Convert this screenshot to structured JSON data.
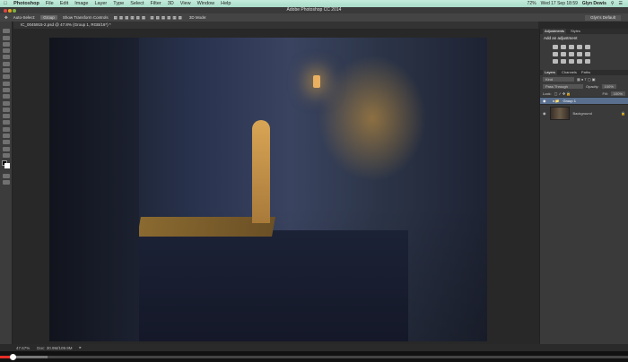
{
  "menubar": {
    "app": "Photoshop",
    "items": [
      "File",
      "Edit",
      "Image",
      "Layer",
      "Type",
      "Select",
      "Filter",
      "3D",
      "View",
      "Window",
      "Help"
    ],
    "battery": "72%",
    "datetime": "Wed 17 Sep  18:59",
    "user": "Glyn Dewis"
  },
  "titlebar": {
    "title": "Adobe Photoshop CC 2014"
  },
  "options": {
    "auto_select": "Auto-Select:",
    "auto_select_value": "Group",
    "transform": "Show Transform Controls",
    "mode3d": "3D Mode:",
    "workspace": "Glyn's Default"
  },
  "document": {
    "tab": "IC_0045915-2.psd @ 47.8% (Group 1, RGB/16*) *"
  },
  "panels": {
    "adjustments": {
      "tabs": [
        "Adjustments",
        "Styles"
      ],
      "heading": "Add an adjustment"
    },
    "layers": {
      "tabs": [
        "Layers",
        "Channels",
        "Paths"
      ],
      "filter": "Kind",
      "blend": "Pass Through",
      "opacity_label": "Opacity:",
      "opacity": "100%",
      "lock_label": "Lock:",
      "fill_label": "Fill:",
      "fill": "100%",
      "items": [
        {
          "name": "Group 1",
          "selected": true
        },
        {
          "name": "Background",
          "locked": true
        }
      ]
    }
  },
  "statusbar": {
    "zoom": "47.67%",
    "doc": "Doc: 30.9M/109.9M"
  },
  "video": {
    "progress_percent": 2,
    "played_color": "#e52d27"
  }
}
